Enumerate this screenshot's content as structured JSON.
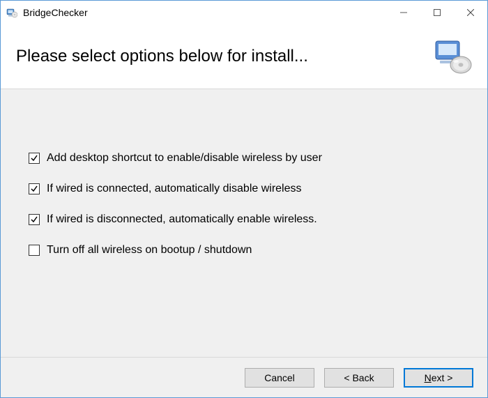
{
  "window": {
    "title": "BridgeChecker"
  },
  "header": {
    "title": "Please select options below for install..."
  },
  "options": [
    {
      "label": "Add desktop shortcut to enable/disable wireless by user",
      "checked": true
    },
    {
      "label": "If wired is connected, automatically disable wireless",
      "checked": true
    },
    {
      "label": "If wired is disconnected, automatically enable wireless.",
      "checked": true
    },
    {
      "label": "Turn off all wireless on bootup / shutdown",
      "checked": false
    }
  ],
  "buttons": {
    "cancel": "Cancel",
    "back": "< Back",
    "next_prefix": "N",
    "next_suffix": "ext >"
  }
}
